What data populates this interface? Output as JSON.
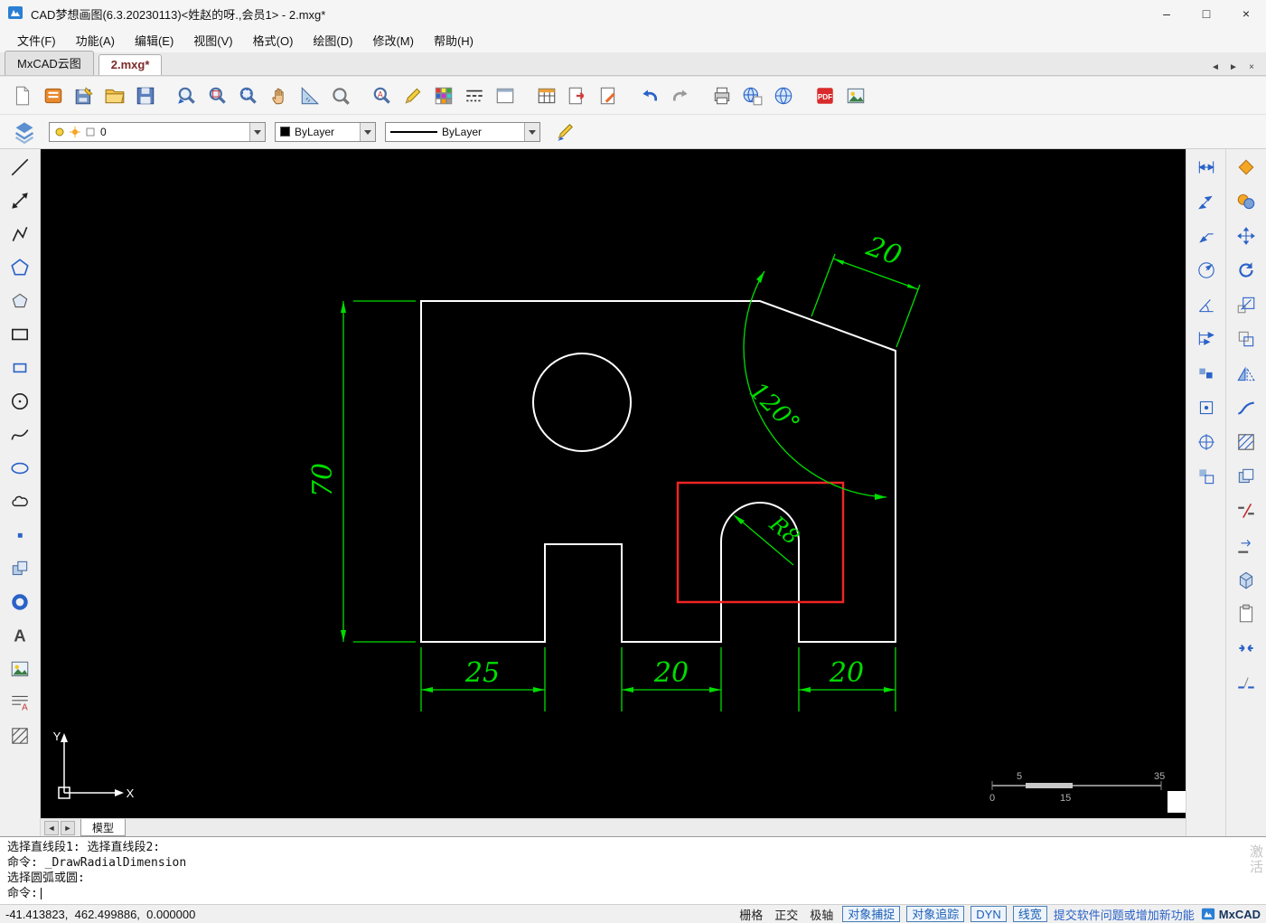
{
  "window": {
    "title": "CAD梦想画图(6.3.20230113)<姓赵的呀.,会员1> - 2.mxg*"
  },
  "icons": {
    "minimize": "–",
    "maximize": "□",
    "close": "×",
    "tab_prev": "◄",
    "tab_next": "►",
    "tab_close": "×",
    "sheet_prev": "◄",
    "sheet_next": "►",
    "pdf_text": "PDF",
    "text_a": "A",
    "find_a": "A"
  },
  "menu": {
    "items": [
      "文件(F)",
      "功能(A)",
      "编辑(E)",
      "视图(V)",
      "格式(O)",
      "绘图(D)",
      "修改(M)",
      "帮助(H)"
    ]
  },
  "doc_tabs": {
    "items": [
      "MxCAD云图",
      "2.mxg*"
    ]
  },
  "props": {
    "layer": "0",
    "color": "ByLayer",
    "linetype": "ByLayer"
  },
  "drawing": {
    "dim_height": "70",
    "dim_w1": "25",
    "dim_w2": "20",
    "dim_w3": "20",
    "dim_chamfer": "20",
    "dim_angle": "120°",
    "dim_radius": "R8",
    "ucs_x": "X",
    "ucs_y": "Y",
    "ruler": {
      "top_left": "5",
      "top_right": "35",
      "bottom_left": "0",
      "bottom_mid": "15"
    }
  },
  "sheet": {
    "model": "模型"
  },
  "command": {
    "lines": [
      "选择直线段1: 选择直线段2:",
      "命令: _DrawRadialDimension",
      "选择圆弧或圆:",
      "命令:"
    ]
  },
  "status": {
    "coords": "-41.413823,  462.499886,  0.000000",
    "t1": "栅格",
    "t2": "正交",
    "t3": "极轴",
    "b1": "对象捕捉",
    "b2": "对象追踪",
    "b3": "DYN",
    "b4": "线宽",
    "link": "提交软件问题或增加新功能",
    "brand": "MxCAD"
  },
  "watermark": "激活"
}
